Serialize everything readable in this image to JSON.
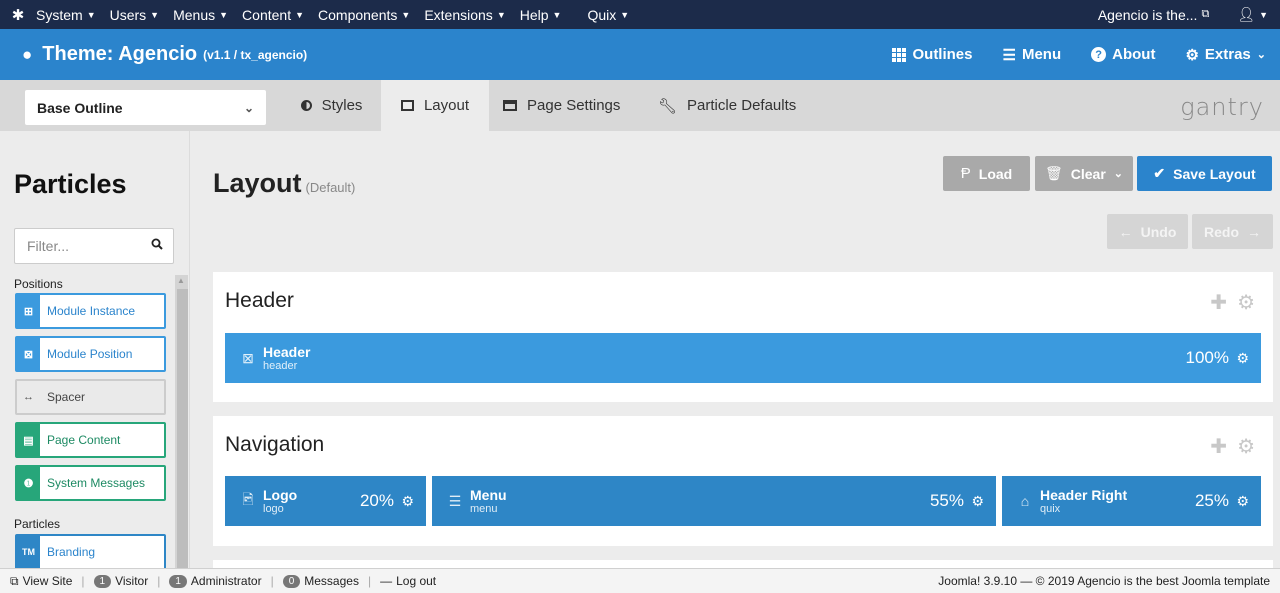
{
  "topbar": {
    "menus": [
      "System",
      "Users",
      "Menus",
      "Content",
      "Components",
      "Extensions",
      "Help",
      "Quix"
    ],
    "site_name": "Agencio is the...",
    "user_icon": "user-icon"
  },
  "theme": {
    "title": "Theme: Agencio",
    "version": "(v1.1 / tx_agencio)",
    "nav": {
      "outlines": "Outlines",
      "menu": "Menu",
      "about": "About",
      "extras": "Extras"
    }
  },
  "tabs": {
    "outline": "Base Outline",
    "styles": "Styles",
    "layout": "Layout",
    "page_settings": "Page Settings",
    "particle_defaults": "Particle Defaults",
    "brand": "gantry"
  },
  "sidebar": {
    "title": "Particles",
    "filter_placeholder": "Filter...",
    "positions_label": "Positions",
    "particles_label": "Particles",
    "items": [
      {
        "label": "Module Instance",
        "color": "#3b9ade",
        "icon": "module-instance-icon"
      },
      {
        "label": "Module Position",
        "color": "#3b9ade",
        "icon": "module-position-icon"
      },
      {
        "label": "Spacer",
        "color": "#cccccc",
        "icon": "spacer-icon"
      },
      {
        "label": "Page Content",
        "color": "#27a67a",
        "icon": "page-content-icon"
      },
      {
        "label": "System Messages",
        "color": "#27a67a",
        "icon": "system-messages-icon"
      }
    ],
    "branding": {
      "label": "Branding",
      "icon_text": "TM",
      "color": "#2e86c6"
    }
  },
  "main": {
    "title": "Layout",
    "subtitle": "(Default)",
    "buttons": {
      "load": "Load",
      "clear": "Clear",
      "save": "Save Layout",
      "undo": "Undo",
      "redo": "Redo"
    },
    "sections": [
      {
        "title": "Header",
        "blocks": [
          {
            "name": "Header",
            "sub": "header",
            "pct": "100%",
            "icon": "module-icon"
          }
        ]
      },
      {
        "title": "Navigation",
        "blocks": [
          {
            "name": "Logo",
            "sub": "logo",
            "pct": "20%",
            "icon": "image-icon"
          },
          {
            "name": "Menu",
            "sub": "menu",
            "pct": "55%",
            "icon": "menu-icon"
          },
          {
            "name": "Header Right",
            "sub": "quix",
            "pct": "25%",
            "icon": "home-icon"
          }
        ]
      }
    ]
  },
  "status": {
    "view_site": "View Site",
    "visitor_count": "1",
    "visitor_label": "Visitor",
    "admin_count": "1",
    "admin_label": "Administrator",
    "messages_count": "0",
    "messages_label": "Messages",
    "logout": "Log out",
    "copyright": "Joomla! 3.9.10 — © 2019 Agencio is the best Joomla template"
  }
}
